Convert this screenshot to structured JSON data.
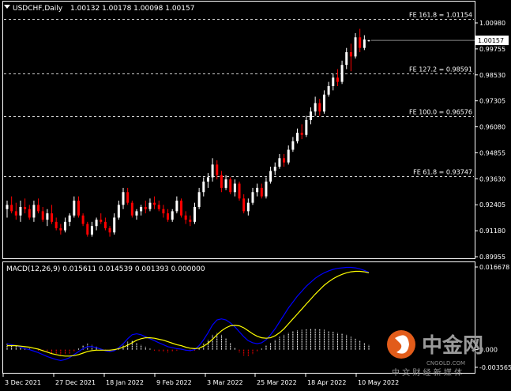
{
  "header": {
    "symbol_label": "USDCHF,Daily",
    "ohlc_label": "1.00132 1.00178 1.00098 1.00157"
  },
  "price_axis": {
    "ticks": [
      "1.00980",
      "0.99755",
      "0.98530",
      "0.97305",
      "0.96080",
      "0.94855",
      "0.93630",
      "0.92405",
      "0.91180",
      "0.89955"
    ],
    "current_label": "1.00157"
  },
  "fib_levels": [
    {
      "label": "FE 161.8 = 1.01154",
      "price": 1.01154
    },
    {
      "label": "FE 127.2 = 0.98591",
      "price": 0.98591
    },
    {
      "label": "FE 100.0 = 0.96576",
      "price": 0.96576
    },
    {
      "label": "FE 61.8 = 0.93747",
      "price": 0.93747
    }
  ],
  "macd_panel": {
    "title": "MACD(12,26,9) 0.015611 0.014539 0.001393 0.000000",
    "axis_ticks": [
      "0.016678",
      "0.000",
      "-0.003565"
    ]
  },
  "date_axis": [
    "3 Dec 2021",
    "27 Dec 2021",
    "18 Jan 2022",
    "9 Feb 2022",
    "3 Mar 2022",
    "25 Mar 2022",
    "18 Apr 2022",
    "10 May 2022"
  ],
  "watermark": {
    "brand": "中金网",
    "site": "CNGOLD.COM",
    "tagline": "中 文 财 经 新 媒 体"
  },
  "colors": {
    "background": "#000000",
    "bull": "#ffffff",
    "bear": "#ff0000",
    "grid": "#ffffff",
    "macd_line": "#0000ff",
    "signal_line": "#ffff00",
    "panel_border": "#ffffff"
  },
  "chart_data": {
    "type": "candlestick",
    "symbol": "USDCHF",
    "timeframe": "Daily",
    "ylim": [
      0.89955,
      1.0098
    ],
    "x_start": "2021-12-01",
    "ohlc": [
      [
        0.922,
        0.926,
        0.918,
        0.924
      ],
      [
        0.924,
        0.928,
        0.92,
        0.921
      ],
      [
        0.921,
        0.925,
        0.917,
        0.919
      ],
      [
        0.919,
        0.926,
        0.916,
        0.923
      ],
      [
        0.923,
        0.927,
        0.92,
        0.922
      ],
      [
        0.922,
        0.924,
        0.917,
        0.918
      ],
      [
        0.918,
        0.926,
        0.916,
        0.924
      ],
      [
        0.924,
        0.927,
        0.92,
        0.921
      ],
      [
        0.921,
        0.923,
        0.916,
        0.917
      ],
      [
        0.917,
        0.922,
        0.914,
        0.92
      ],
      [
        0.92,
        0.924,
        0.915,
        0.916
      ],
      [
        0.916,
        0.918,
        0.912,
        0.913
      ],
      [
        0.913,
        0.915,
        0.91,
        0.912
      ],
      [
        0.912,
        0.918,
        0.911,
        0.916
      ],
      [
        0.916,
        0.92,
        0.914,
        0.919
      ],
      [
        0.919,
        0.928,
        0.918,
        0.926
      ],
      [
        0.926,
        0.928,
        0.918,
        0.919
      ],
      [
        0.919,
        0.92,
        0.914,
        0.915
      ],
      [
        0.915,
        0.916,
        0.909,
        0.91
      ],
      [
        0.91,
        0.916,
        0.909,
        0.914
      ],
      [
        0.914,
        0.918,
        0.912,
        0.917
      ],
      [
        0.917,
        0.92,
        0.915,
        0.916
      ],
      [
        0.916,
        0.918,
        0.912,
        0.913
      ],
      [
        0.913,
        0.914,
        0.909,
        0.911
      ],
      [
        0.911,
        0.92,
        0.91,
        0.918
      ],
      [
        0.918,
        0.926,
        0.917,
        0.924
      ],
      [
        0.924,
        0.932,
        0.922,
        0.93
      ],
      [
        0.93,
        0.932,
        0.924,
        0.925
      ],
      [
        0.925,
        0.926,
        0.918,
        0.919
      ],
      [
        0.919,
        0.922,
        0.917,
        0.921
      ],
      [
        0.921,
        0.924,
        0.919,
        0.923
      ],
      [
        0.923,
        0.926,
        0.92,
        0.922
      ],
      [
        0.922,
        0.927,
        0.921,
        0.925
      ],
      [
        0.925,
        0.928,
        0.922,
        0.924
      ],
      [
        0.924,
        0.926,
        0.921,
        0.922
      ],
      [
        0.922,
        0.924,
        0.918,
        0.92
      ],
      [
        0.92,
        0.922,
        0.916,
        0.917
      ],
      [
        0.917,
        0.922,
        0.916,
        0.921
      ],
      [
        0.921,
        0.928,
        0.92,
        0.926
      ],
      [
        0.926,
        0.927,
        0.918,
        0.919
      ],
      [
        0.919,
        0.921,
        0.915,
        0.917
      ],
      [
        0.917,
        0.919,
        0.914,
        0.916
      ],
      [
        0.916,
        0.925,
        0.915,
        0.923
      ],
      [
        0.923,
        0.932,
        0.922,
        0.93
      ],
      [
        0.93,
        0.937,
        0.928,
        0.935
      ],
      [
        0.935,
        0.939,
        0.932,
        0.937
      ],
      [
        0.937,
        0.946,
        0.935,
        0.943
      ],
      [
        0.943,
        0.945,
        0.936,
        0.938
      ],
      [
        0.938,
        0.94,
        0.93,
        0.932
      ],
      [
        0.932,
        0.938,
        0.931,
        0.936
      ],
      [
        0.936,
        0.937,
        0.929,
        0.93
      ],
      [
        0.93,
        0.936,
        0.928,
        0.934
      ],
      [
        0.934,
        0.935,
        0.926,
        0.927
      ],
      [
        0.927,
        0.929,
        0.92,
        0.921
      ],
      [
        0.921,
        0.927,
        0.919,
        0.925
      ],
      [
        0.925,
        0.932,
        0.924,
        0.93
      ],
      [
        0.93,
        0.934,
        0.928,
        0.932
      ],
      [
        0.932,
        0.934,
        0.927,
        0.928
      ],
      [
        0.928,
        0.937,
        0.927,
        0.935
      ],
      [
        0.935,
        0.942,
        0.934,
        0.94
      ],
      [
        0.94,
        0.944,
        0.938,
        0.942
      ],
      [
        0.942,
        0.948,
        0.941,
        0.946
      ],
      [
        0.946,
        0.948,
        0.942,
        0.944
      ],
      [
        0.944,
        0.952,
        0.943,
        0.95
      ],
      [
        0.95,
        0.956,
        0.949,
        0.954
      ],
      [
        0.954,
        0.96,
        0.953,
        0.958
      ],
      [
        0.958,
        0.962,
        0.955,
        0.957
      ],
      [
        0.957,
        0.966,
        0.956,
        0.964
      ],
      [
        0.964,
        0.97,
        0.962,
        0.968
      ],
      [
        0.968,
        0.975,
        0.966,
        0.972
      ],
      [
        0.972,
        0.974,
        0.966,
        0.968
      ],
      [
        0.968,
        0.978,
        0.967,
        0.976
      ],
      [
        0.976,
        0.982,
        0.975,
        0.98
      ],
      [
        0.98,
        0.986,
        0.978,
        0.984
      ],
      [
        0.984,
        0.988,
        0.98,
        0.982
      ],
      [
        0.982,
        0.992,
        0.981,
        0.99
      ],
      [
        0.99,
        0.998,
        0.988,
        0.996
      ],
      [
        0.996,
        1.0,
        0.987,
        0.994
      ],
      [
        0.994,
        1.005,
        0.993,
        1.003
      ],
      [
        1.003,
        1.007,
        0.996,
        0.998
      ],
      [
        0.998,
        1.004,
        0.997,
        1.002
      ],
      [
        1.00132,
        1.00178,
        1.00098,
        1.00157
      ]
    ],
    "macd": {
      "params": "12,26,9",
      "ylim": [
        -0.003565,
        0.016678
      ],
      "histogram": [
        0.0012,
        0.001,
        0.0008,
        0.0006,
        0.0004,
        0.0002,
        0.0,
        -0.0002,
        -0.0004,
        -0.0006,
        -0.0008,
        -0.001,
        -0.0011,
        -0.001,
        -0.0008,
        -0.0004,
        0.0002,
        0.0008,
        0.0012,
        0.001,
        0.0006,
        0.0002,
        -0.0002,
        -0.0004,
        -0.0002,
        0.0004,
        0.001,
        0.0016,
        0.0018,
        0.0014,
        0.001,
        0.0006,
        0.0002,
        -0.0002,
        -0.0004,
        -0.0005,
        -0.0006,
        -0.0004,
        -0.0002,
        0.0,
        -0.0002,
        -0.0004,
        -0.0002,
        0.0004,
        0.0012,
        0.002,
        0.003,
        0.0034,
        0.003,
        0.0024,
        0.0014,
        0.0004,
        -0.0006,
        -0.0012,
        -0.0014,
        -0.001,
        -0.0004,
        0.0002,
        0.0008,
        0.0014,
        0.002,
        0.0026,
        0.003,
        0.0034,
        0.0037,
        0.0039,
        0.004,
        0.0041,
        0.0042,
        0.0042,
        0.0041,
        0.004,
        0.0038,
        0.0036,
        0.0034,
        0.0032,
        0.003,
        0.0026,
        0.0022,
        0.0018,
        0.0014,
        0.001
      ],
      "macd_line": [
        0.0012,
        0.001,
        0.0008,
        0.0005,
        0.0002,
        0.0,
        -0.0003,
        -0.0006,
        -0.001,
        -0.0014,
        -0.0017,
        -0.002,
        -0.0022,
        -0.002,
        -0.0016,
        -0.001,
        -0.0004,
        0.0002,
        0.0006,
        0.0006,
        0.0004,
        0.0001,
        -0.0002,
        -0.0004,
        -0.0002,
        0.0004,
        0.0012,
        0.0022,
        0.003,
        0.0032,
        0.003,
        0.0026,
        0.0022,
        0.0018,
        0.0014,
        0.001,
        0.0006,
        0.0004,
        0.0002,
        0.0001,
        -0.0001,
        -0.0002,
        0.0,
        0.0008,
        0.002,
        0.0034,
        0.005,
        0.006,
        0.0062,
        0.006,
        0.0054,
        0.0046,
        0.0036,
        0.0026,
        0.0018,
        0.0014,
        0.0012,
        0.0014,
        0.002,
        0.003,
        0.0042,
        0.0056,
        0.007,
        0.0084,
        0.0096,
        0.0108,
        0.0118,
        0.0128,
        0.0136,
        0.0144,
        0.015,
        0.0155,
        0.0159,
        0.0162,
        0.0164,
        0.0165,
        0.0166,
        0.0166,
        0.0165,
        0.0163,
        0.016,
        0.0156
      ],
      "signal_line": [
        0.0008,
        0.0008,
        0.0008,
        0.0007,
        0.0006,
        0.0005,
        0.0003,
        0.0001,
        -0.0002,
        -0.0005,
        -0.0008,
        -0.001,
        -0.0012,
        -0.0013,
        -0.0013,
        -0.0012,
        -0.001,
        -0.0007,
        -0.0004,
        -0.0002,
        -0.0001,
        -0.0001,
        -0.0001,
        -0.0001,
        0.0,
        0.0002,
        0.0005,
        0.0009,
        0.0014,
        0.0019,
        0.0022,
        0.0024,
        0.0024,
        0.0023,
        0.0021,
        0.0019,
        0.0016,
        0.0013,
        0.001,
        0.0008,
        0.0005,
        0.0003,
        0.0002,
        0.0003,
        0.0007,
        0.0013,
        0.0021,
        0.003,
        0.0038,
        0.0044,
        0.0048,
        0.0049,
        0.0048,
        0.0044,
        0.0038,
        0.0032,
        0.0027,
        0.0024,
        0.0023,
        0.0024,
        0.0028,
        0.0034,
        0.0042,
        0.0052,
        0.0062,
        0.0072,
        0.0082,
        0.0092,
        0.0102,
        0.0112,
        0.0121,
        0.013,
        0.0137,
        0.0143,
        0.0148,
        0.0152,
        0.0155,
        0.0157,
        0.0158,
        0.0158,
        0.0157,
        0.0155
      ]
    }
  }
}
